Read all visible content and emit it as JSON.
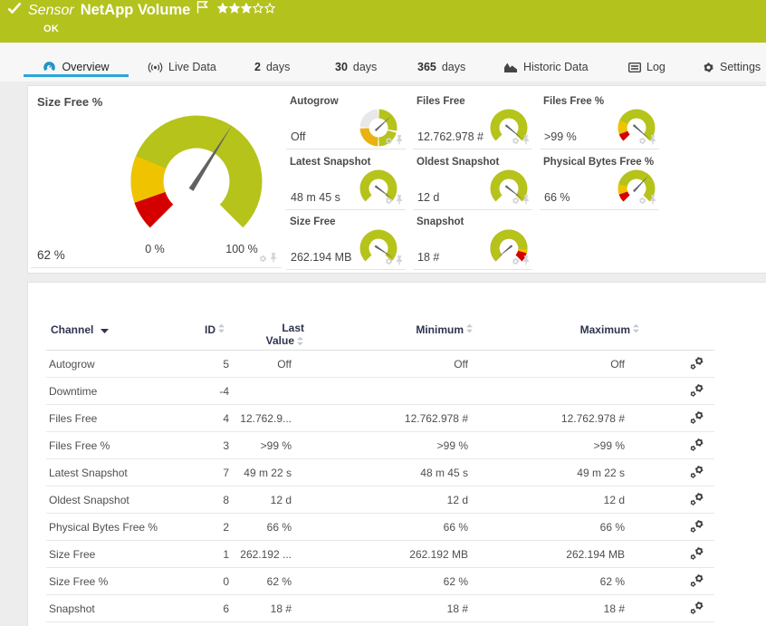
{
  "header": {
    "type_label": "Sensor",
    "title": "NetApp Volume",
    "status": "OK",
    "rating": {
      "filled": 3,
      "total": 5
    },
    "color": "#b4c21d"
  },
  "tabs": [
    {
      "label": "Overview",
      "icon": "gauge-icon",
      "active": true
    },
    {
      "label": "Live Data",
      "icon": "broadcast-icon",
      "active": false
    },
    {
      "prefix": "2",
      "label": "days",
      "icon": "",
      "active": false
    },
    {
      "prefix": "30",
      "label": "days",
      "icon": "",
      "active": false
    },
    {
      "prefix": "365",
      "label": "days",
      "icon": "",
      "active": false
    },
    {
      "label": "Historic Data",
      "icon": "area-chart-icon",
      "active": false
    },
    {
      "label": "Log",
      "icon": "log-icon",
      "active": false
    },
    {
      "label": "Settings",
      "icon": "gear-icon",
      "active": false
    }
  ],
  "colors": {
    "ok_green": "#b5c31b",
    "warning_yellow": "#f0c300",
    "error_red": "#d40000",
    "lookup_gray": "#e8e8ea",
    "accent_blue": "#2aa5dc"
  },
  "gauges": {
    "big": {
      "title": "Size Free %",
      "value": "62 %",
      "min_label": "0 %",
      "max_label": "100 %",
      "needle_fraction": 0.62,
      "segments": [
        {
          "from": 0,
          "to": 0.09,
          "color": "#d40000"
        },
        {
          "from": 0.09,
          "to": 0.245,
          "color": "#f0c300"
        },
        {
          "from": 0.25,
          "to": 1,
          "color": "#b5c31b"
        }
      ]
    },
    "small": [
      {
        "title": "Autogrow",
        "value": "Off",
        "type": "lookup",
        "needle_deg": 47,
        "ring_segments": [
          {
            "from_deg": 2,
            "to_deg": 100,
            "color": "#b5c31b"
          },
          {
            "from_deg": 106,
            "to_deg": 178,
            "color": "#b5c31b"
          },
          {
            "from_deg": 182,
            "to_deg": 268,
            "color": "#e9b212"
          },
          {
            "from_deg": 272,
            "to_deg": 358,
            "color": "#e8e8ea"
          }
        ]
      },
      {
        "title": "Files Free",
        "value": "12.762.978 #",
        "type": "gauge",
        "needle_fraction": 0.981,
        "segments": [
          {
            "from": 0,
            "to": 1,
            "color": "#b5c31b"
          }
        ]
      },
      {
        "title": "Files Free %",
        "value": ">99 %",
        "type": "gauge",
        "needle_fraction": 0.987,
        "segments": [
          {
            "from": 0,
            "to": 0.085,
            "color": "#d40000"
          },
          {
            "from": 0.085,
            "to": 0.25,
            "color": "#f0c300"
          },
          {
            "from": 0.25,
            "to": 1,
            "color": "#b5c31b"
          }
        ]
      },
      {
        "title": "Latest Snapshot",
        "value": "48 m 45 s",
        "type": "gauge",
        "needle_fraction": 0.971,
        "segments": [
          {
            "from": 0,
            "to": 1,
            "color": "#b5c31b"
          }
        ]
      },
      {
        "title": "Oldest Snapshot",
        "value": "12 d",
        "type": "gauge",
        "needle_fraction": 0.974,
        "segments": [
          {
            "from": 0,
            "to": 1,
            "color": "#b5c31b"
          }
        ]
      },
      {
        "title": "Physical Bytes Free %",
        "value": "66 %",
        "type": "gauge",
        "needle_fraction": 0.66,
        "segments": [
          {
            "from": 0,
            "to": 0.09,
            "color": "#d40000"
          },
          {
            "from": 0.09,
            "to": 0.21,
            "color": "#f0c300"
          },
          {
            "from": 0.21,
            "to": 1,
            "color": "#b5c31b"
          }
        ]
      },
      {
        "title": "Size Free",
        "value": "262.194 MB",
        "type": "gauge",
        "needle_fraction": 0.958,
        "segments": [
          {
            "from": 0,
            "to": 1,
            "color": "#b5c31b"
          }
        ]
      },
      {
        "title": "Snapshot",
        "value": "18 #",
        "type": "gauge",
        "needle_fraction": 0.02,
        "needle_len": 15.5,
        "segments": [
          {
            "from": 0,
            "to": 0.845,
            "color": "#b5c31b"
          },
          {
            "from": 0.845,
            "to": 0.885,
            "color": "#f0c300"
          },
          {
            "from": 0.885,
            "to": 1,
            "color": "#d40000"
          }
        ]
      }
    ]
  },
  "table": {
    "columns": {
      "channel": "Channel",
      "id": "ID",
      "last": "Last Value",
      "min": "Minimum",
      "max": "Maximum"
    },
    "sorted_by": "Channel",
    "rows": [
      {
        "channel": "Autogrow",
        "id": "5",
        "last": "Off",
        "min": "Off",
        "max": "Off"
      },
      {
        "channel": "Downtime",
        "id": "-4",
        "last": "",
        "min": "",
        "max": ""
      },
      {
        "channel": "Files Free",
        "id": "4",
        "last": "12.762.9...",
        "min": "12.762.978 #",
        "max": "12.762.978 #"
      },
      {
        "channel": "Files Free %",
        "id": "3",
        "last": ">99 %",
        "min": ">99 %",
        "max": ">99 %"
      },
      {
        "channel": "Latest Snapshot",
        "id": "7",
        "last": "49 m 22 s",
        "min": "48 m 45 s",
        "max": "49 m 22 s"
      },
      {
        "channel": "Oldest Snapshot",
        "id": "8",
        "last": "12 d",
        "min": "12 d",
        "max": "12 d"
      },
      {
        "channel": "Physical Bytes Free %",
        "id": "2",
        "last": "66 %",
        "min": "66 %",
        "max": "66 %"
      },
      {
        "channel": "Size Free",
        "id": "1",
        "last": "262.192 ...",
        "min": "262.192 MB",
        "max": "262.194 MB"
      },
      {
        "channel": "Size Free %",
        "id": "0",
        "last": "62 %",
        "min": "62 %",
        "max": "62 %"
      },
      {
        "channel": "Snapshot",
        "id": "6",
        "last": "18 #",
        "min": "18 #",
        "max": "18 #"
      }
    ]
  }
}
